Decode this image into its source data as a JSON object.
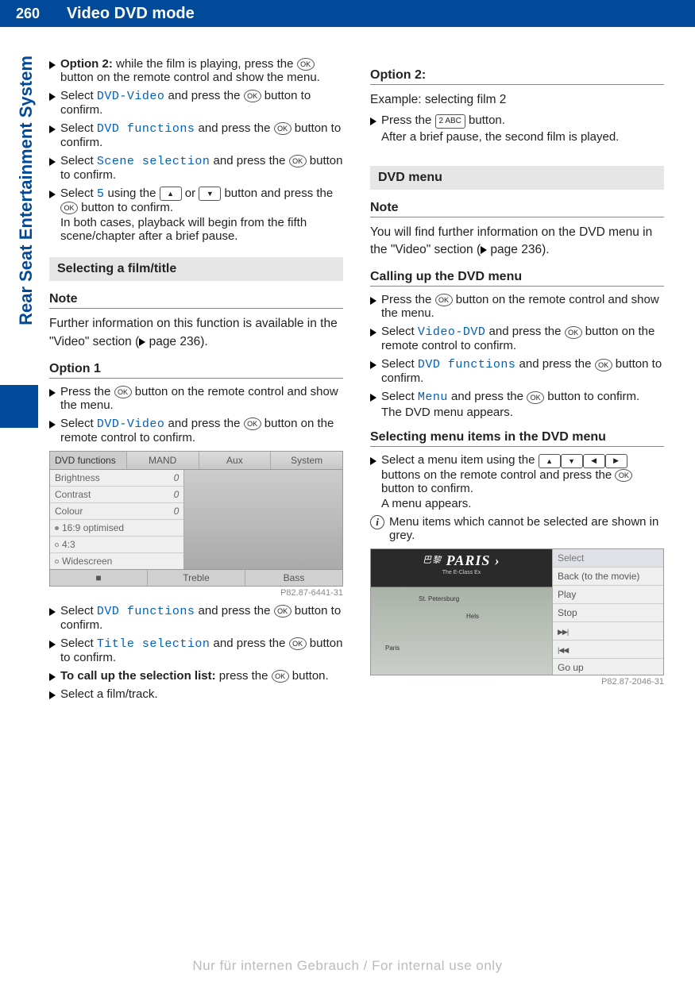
{
  "page_number": "260",
  "chapter_title": "Video DVD mode",
  "sidebar_tab": "Rear Seat Entertainment System",
  "footer": "Nur für internen Gebrauch / For internal use only",
  "ok_label": "OK",
  "col1": {
    "opt2_lead": "Option 2:",
    "opt2_text": " while the film is playing, press the ",
    "opt2_text_b": " button on the remote control and show the menu.",
    "s1a": "Select ",
    "s1_term": "DVD-Video",
    "s1b": " and press the ",
    "s1c": " button to confirm.",
    "s2a": "Select ",
    "s2_term": "DVD functions",
    "s2b": " and press the ",
    "s2c": " button to confirm.",
    "s3a": "Select ",
    "s3_term": "Scene selection",
    "s3b": " and press the ",
    "s3c": " button to confirm.",
    "s4a": "Select ",
    "s4_term": "5",
    "s4b": " using the ",
    "s4c": " or ",
    "s4d": " button and press the ",
    "s4e": " button to confirm.",
    "s4_note": "In both cases, playback will begin from the fifth scene/chapter after a brief pause.",
    "sec_selecting": "Selecting a film/title",
    "note_h": "Note",
    "note_p": "Further information on this function is available in the \"Video\" section (",
    "note_pg": " page 236).",
    "opt1_h": "Option 1",
    "o1s1a": "Press the ",
    "o1s1b": " button on the remote control and show the menu.",
    "o1s2a": "Select ",
    "o1s2_term": "DVD-Video",
    "o1s2b": " and press the ",
    "o1s2c": " button on the remote control to confirm.",
    "shot1": {
      "tab_dvd": "DVD functions",
      "tab_mand": "MAND",
      "tab_aux": "Aux",
      "tab_system": "System",
      "r_brightness": "Brightness",
      "r_contrast": "Contrast",
      "r_colour": "Colour",
      "v0": "0",
      "r_169": "16:9 optimised",
      "r_43": "4:3",
      "r_wide": "Widescreen",
      "b_blank": "■",
      "b_treble": "Treble",
      "b_bass": "Bass",
      "caption": "P82.87-6441-31"
    },
    "o1s3a": "Select ",
    "o1s3_term": "DVD functions",
    "o1s3b": " and press the ",
    "o1s3c": " button to confirm.",
    "o1s4a": "Select ",
    "o1s4_term": "Title selection",
    "o1s4b": " and press the ",
    "o1s4c": " button to confirm.",
    "o1s5_lead": "To call up the selection list:",
    "o1s5a": " press the ",
    "o1s5b": " button.",
    "o1s6": "Select a film/track."
  },
  "col2": {
    "opt2_h": "Option 2:",
    "opt2_ex": "Example: selecting film 2",
    "opt2_s1a": "Press the ",
    "opt2_key": "2 ABC",
    "opt2_s1b": " button.",
    "opt2_s1_note": "After a brief pause, the second film is played.",
    "sec_dvdmenu": "DVD menu",
    "note_h": "Note",
    "note_p1": "You will find further information on the DVD menu in the \"Video\" section (",
    "note_pg": " page 236).",
    "call_h": "Calling up the DVD menu",
    "c_s1a": "Press the ",
    "c_s1b": " button on the remote control and show the menu.",
    "c_s2a": "Select ",
    "c_s2_term": "Video-DVD",
    "c_s2b": " and press the ",
    "c_s2c": " button on the remote control to confirm.",
    "c_s3a": "Select ",
    "c_s3_term": "DVD functions",
    "c_s3b": " and press the ",
    "c_s3c": " button to confirm.",
    "c_s4a": "Select ",
    "c_s4_term": "Menu",
    "c_s4b": " and press the ",
    "c_s4c": " button to confirm.",
    "c_s4_note": "The DVD menu appears.",
    "sel_h": "Selecting menu items in the DVD menu",
    "sel_s1a": "Select a menu item using the ",
    "sel_s1b": " buttons on the remote control and press the ",
    "sel_s1c": " button to confirm.",
    "sel_s1_note": "A menu appears.",
    "info_p": "Menu items which cannot be selected are shown in grey.",
    "shot2": {
      "title_pref": "巴黎",
      "title": "PARIS ›",
      "sub": "The E-Class Ex",
      "city1": "St. Petersburg",
      "city2": "Hels",
      "city3": "Paris",
      "m_select": "Select",
      "m_back": "Back (to the movie)",
      "m_play": "Play",
      "m_stop": "Stop",
      "m_goup": "Go up",
      "caption": "P82.87-2046-31"
    }
  }
}
